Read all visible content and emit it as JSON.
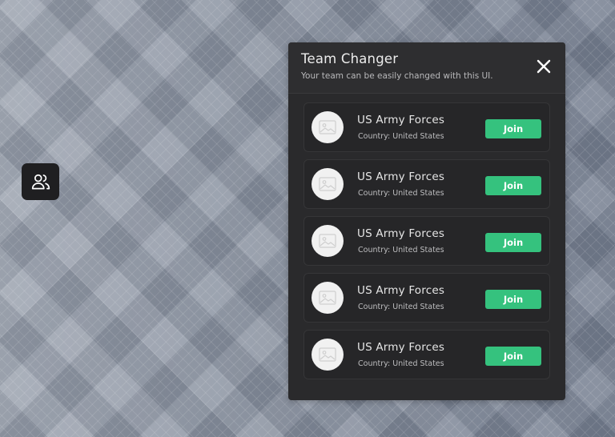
{
  "toggle_button": {
    "icon": "users-icon"
  },
  "team_changer": {
    "title": "Team Changer",
    "subtitle": "Your team can be easily changed with this UI.",
    "close_icon": "close-icon",
    "teams": [
      {
        "name": "US Army Forces",
        "country": "Country: United States",
        "avatar_icon": "image-placeholder-icon",
        "join_label": "Join"
      },
      {
        "name": "US Army Forces",
        "country": "Country: United States",
        "avatar_icon": "image-placeholder-icon",
        "join_label": "Join"
      },
      {
        "name": "US Army Forces",
        "country": "Country: United States",
        "avatar_icon": "image-placeholder-icon",
        "join_label": "Join"
      },
      {
        "name": "US Army Forces",
        "country": "Country: United States",
        "avatar_icon": "image-placeholder-icon",
        "join_label": "Join"
      },
      {
        "name": "US Army Forces",
        "country": "Country: United States",
        "avatar_icon": "image-placeholder-icon",
        "join_label": "Join"
      }
    ]
  },
  "colors": {
    "panel_bg": "#2a2a2c",
    "card_bg": "#262628",
    "join_button": "#35c27e",
    "toggle_bg": "#1f1f21"
  }
}
